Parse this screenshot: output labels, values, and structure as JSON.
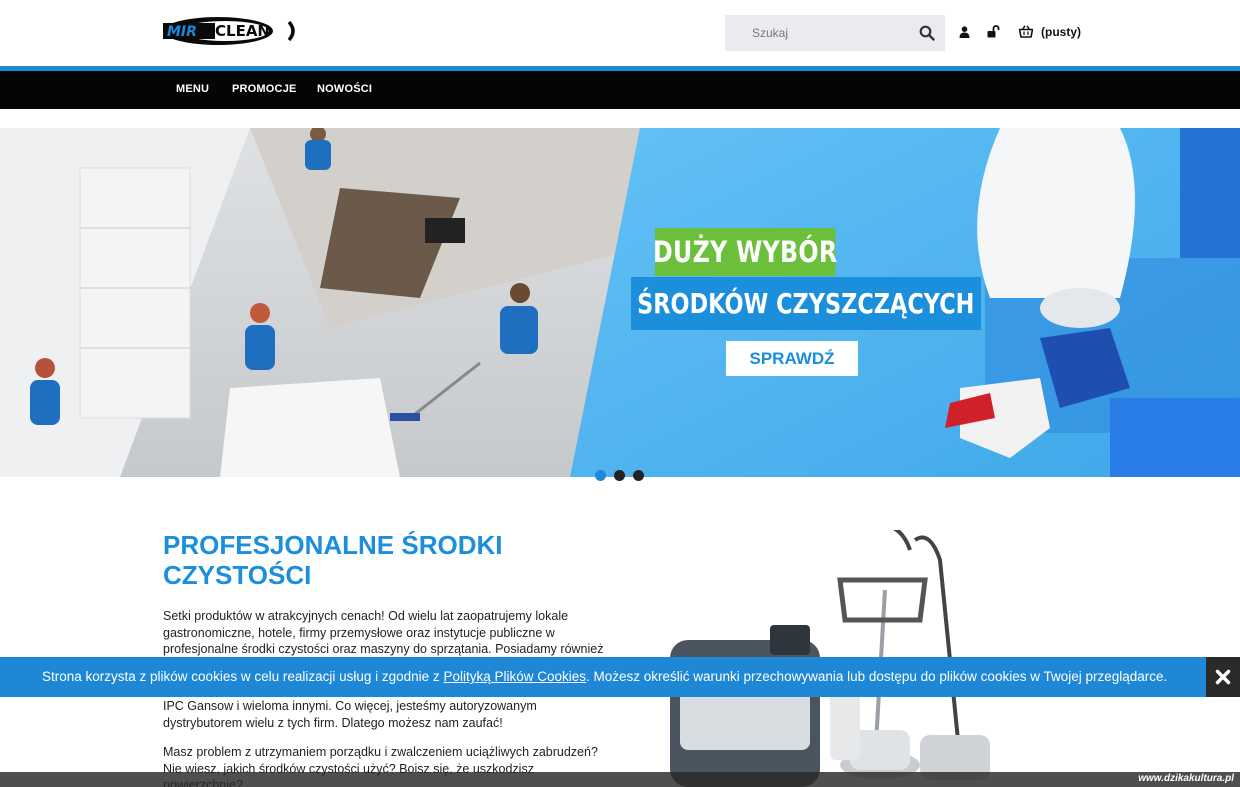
{
  "header": {
    "logo_text_1": "MIR",
    "logo_text_2": "CLEAN",
    "search_placeholder": "Szukaj",
    "cart_label": "(pusty)"
  },
  "nav": {
    "items": [
      {
        "label": "MENU"
      },
      {
        "label": "PROMOCJE"
      },
      {
        "label": "NOWOŚCI"
      }
    ]
  },
  "hero": {
    "line1": "DUŻY WYBÓR",
    "line2": "ŚRODKÓW CZYSZCZĄCYCH",
    "button_label": "SPRAWDŹ",
    "slide_count": 3,
    "active_slide": 1
  },
  "content": {
    "title": "PROFESJONALNE ŚRODKI CZYSTOŚCI",
    "paragraph1_a": "Setki produktów w atrakcyjnych cenach! Od wielu lat zaopatrujemy lokale gastronomiczne, hotele, firmy przemysłowe oraz instytucje publiczne w profesjonalne środki czystości oraz maszyny do sprzątania. Posiadamy również",
    "paragraph1_b": "Sutter, Henkel, Wipetech, Nilfisk, TMB, Tork, Wepa, Frestek, Kleen Purgatis, IPC Gansow i wieloma innymi. Co więcej, jesteśmy autoryzowanym dystrybutorem wielu z tych firm. Dlatego możesz nam zaufać!",
    "paragraph2": "Masz problem z utrzymaniem porządku i zwalczeniem uciążliwych zabrudzeń? Nie wiesz, jakich środków czystości użyć? Boisz się, że uszkodzisz powierzchnię?"
  },
  "cookie": {
    "text_before": "Strona korzysta z plików cookies w celu realizacji usług i zgodnie z ",
    "link_text": "Polityką Plików Cookies",
    "text_after": ". Możesz określić warunki przechowywania lub dostępu do plików cookies w Twojej przeglądarce."
  },
  "watermark": {
    "text": "www.dzikakultura.pl"
  },
  "colors": {
    "accent_blue": "#1e88d6",
    "banner_green": "#6cbf3a",
    "nav_black": "#050505"
  }
}
